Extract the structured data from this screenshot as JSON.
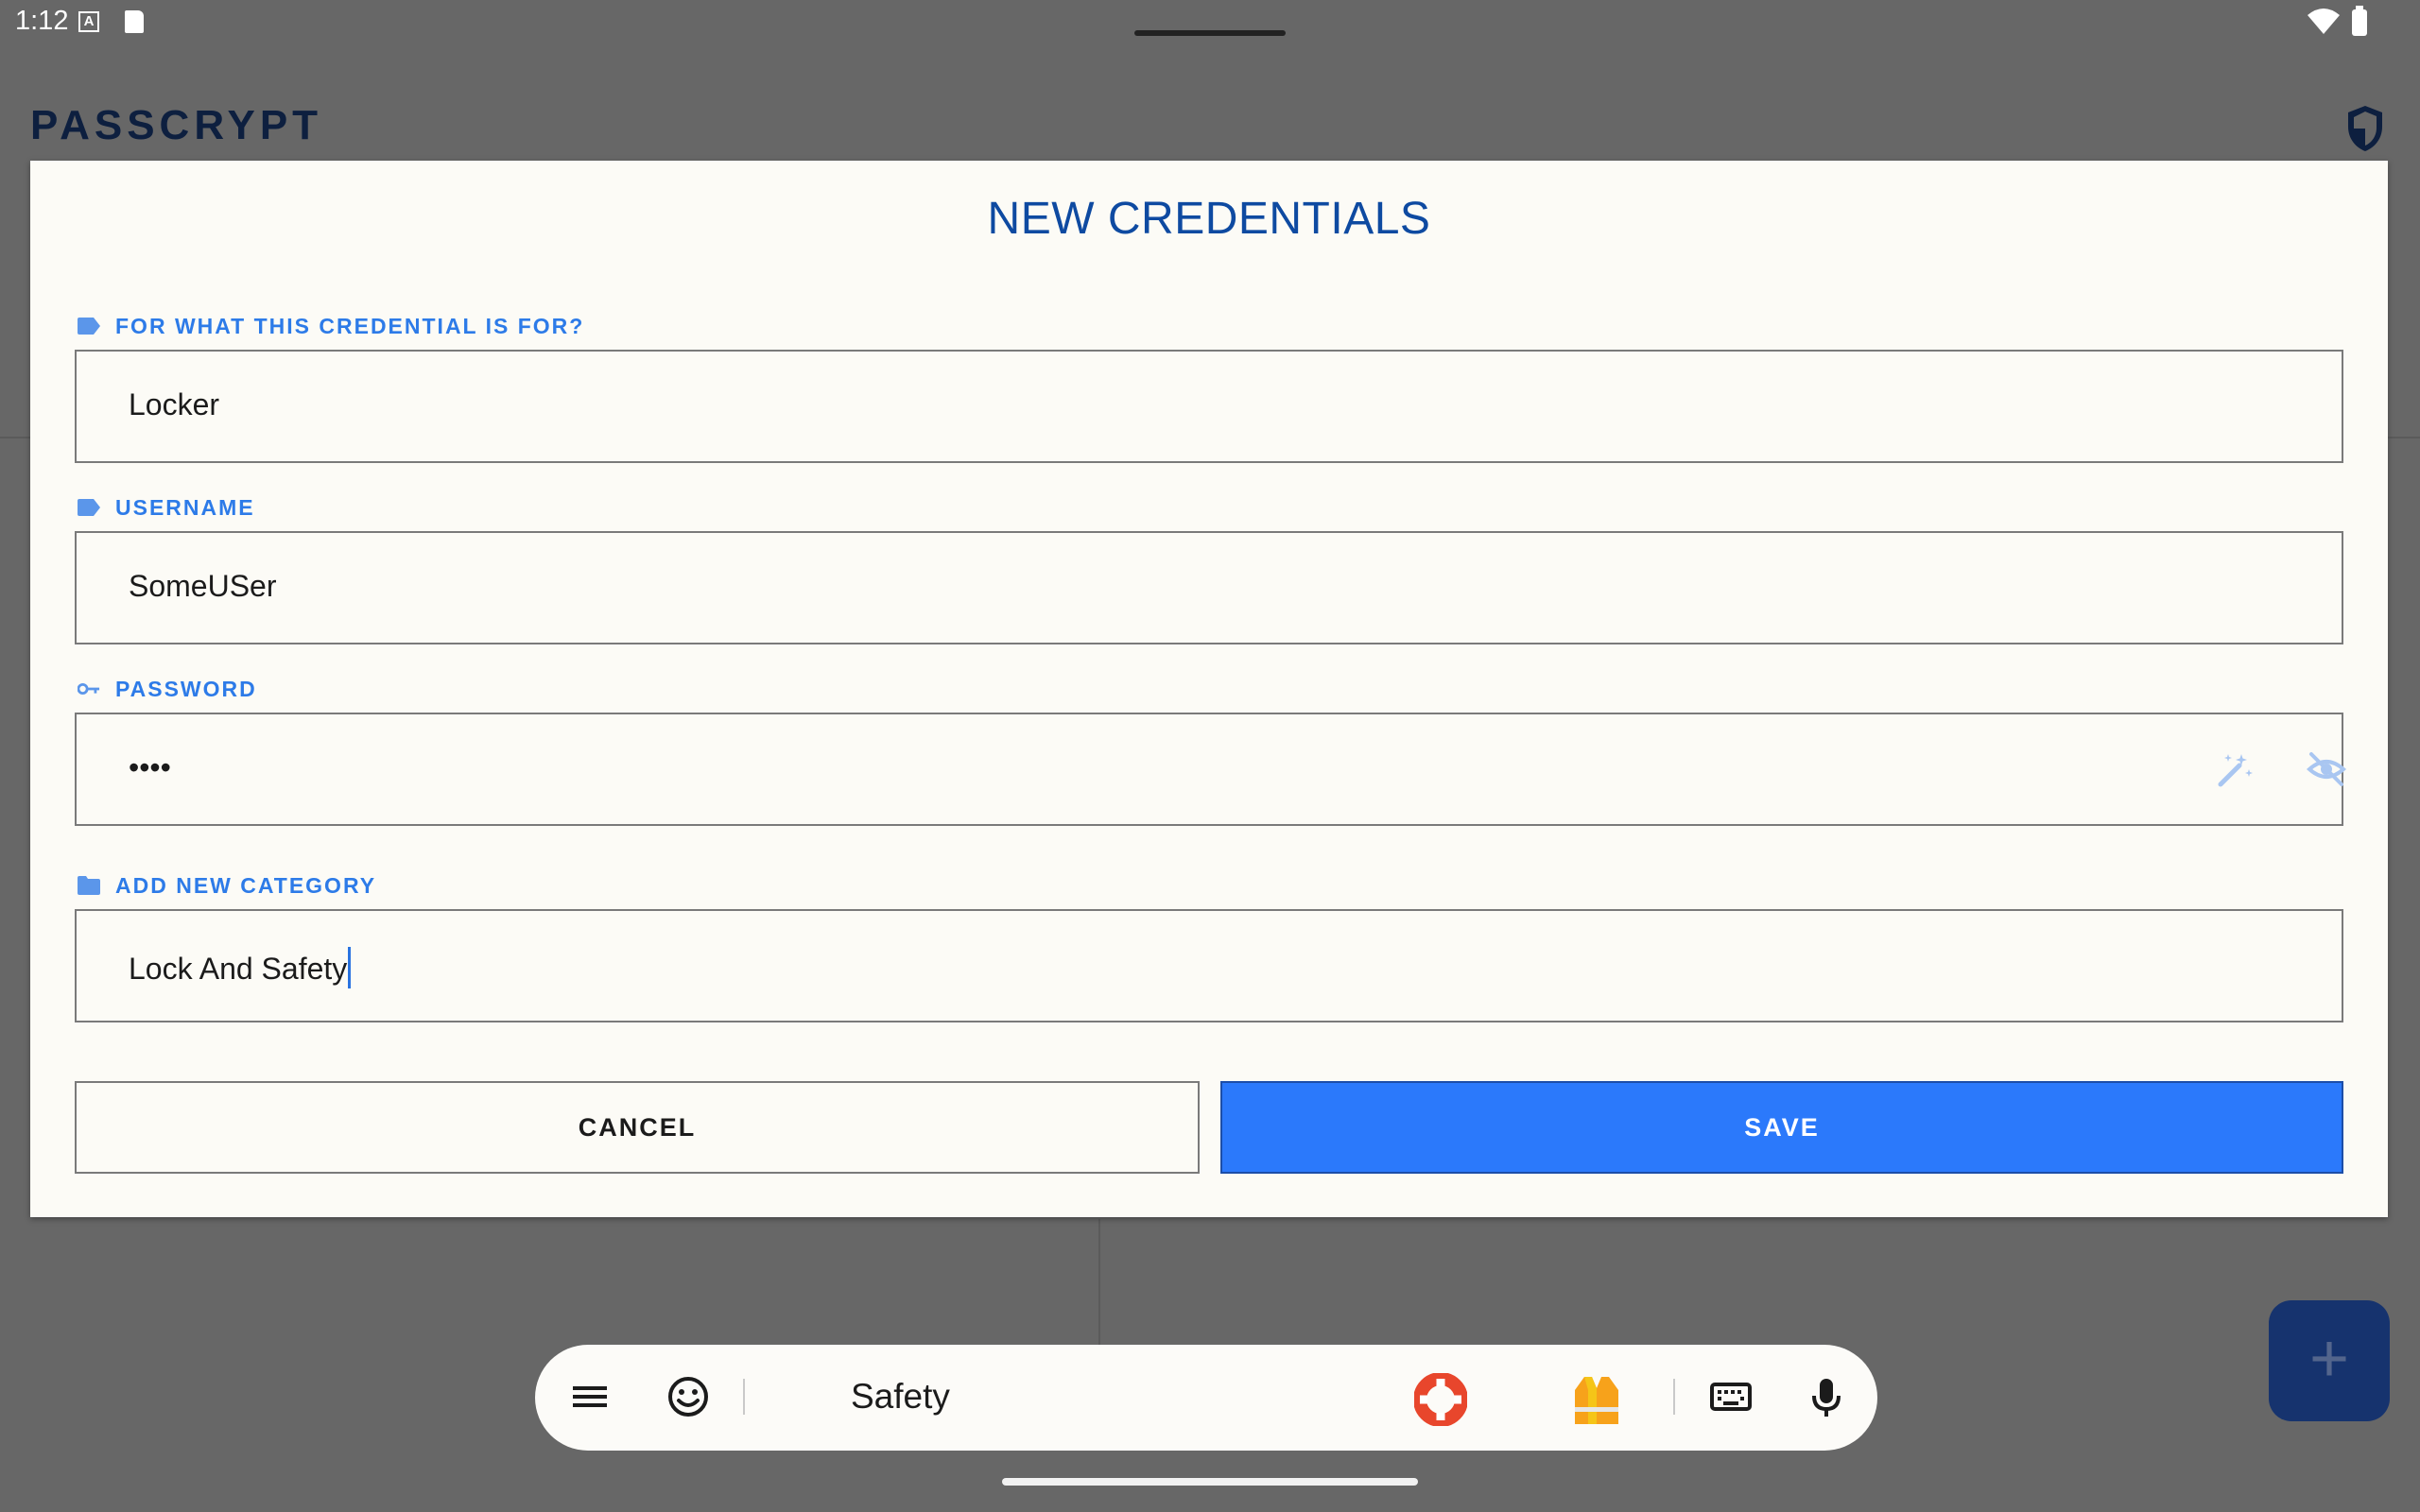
{
  "status_bar": {
    "time": "1:12",
    "a_icon_letter": "A"
  },
  "app_bar": {
    "title": "PASSCRYPT"
  },
  "dialog": {
    "title": "NEW CREDENTIALS",
    "fields": {
      "purpose": {
        "label": "FOR WHAT THIS CREDENTIAL IS FOR?",
        "value": "Locker"
      },
      "username": {
        "label": "USERNAME",
        "value": "SomeUSer"
      },
      "password": {
        "label": "PASSWORD",
        "value": "••••"
      },
      "category": {
        "label": "ADD NEW CATEGORY",
        "value": "Lock And Safety"
      }
    },
    "buttons": {
      "cancel": "CANCEL",
      "save": "SAVE"
    }
  },
  "keyboard": {
    "suggestion": "Safety",
    "emoji_1": "🛟",
    "emoji_2": "🦺"
  },
  "fab": {
    "label": "+"
  },
  "colors": {
    "accent": "#2b79fb",
    "title_blue": "#0e4aa1",
    "label_blue": "#2d7be8",
    "dialog_bg": "#fcfbf6",
    "scrim": "#676767"
  }
}
